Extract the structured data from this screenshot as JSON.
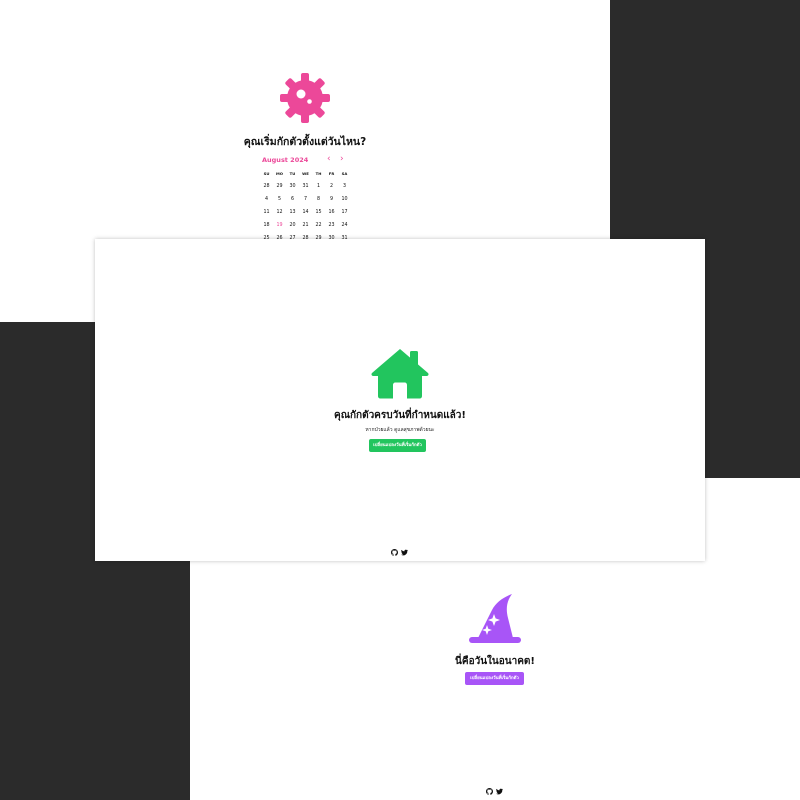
{
  "colors": {
    "pink": "#ec4899",
    "green": "#22c55e",
    "purple": "#a855f7",
    "background": "#2b2b2b"
  },
  "start_screen": {
    "icon": "gear-virus-icon",
    "question": "คุณเริ่มกักตัวตั้งแต่วันไหน?",
    "calendar": {
      "month_label": "August 2024",
      "prev_icon": "‹",
      "next_icon": "›",
      "weekdays": [
        "SU",
        "MO",
        "TU",
        "WE",
        "TH",
        "FR",
        "SA"
      ],
      "days": [
        "28",
        "29",
        "30",
        "31",
        "1",
        "2",
        "3",
        "4",
        "5",
        "6",
        "7",
        "8",
        "9",
        "10",
        "11",
        "12",
        "13",
        "14",
        "15",
        "16",
        "17",
        "18",
        "19",
        "20",
        "21",
        "22",
        "23",
        "24",
        "25",
        "26",
        "27",
        "28",
        "29",
        "30",
        "31"
      ],
      "today": "19"
    }
  },
  "done_screen": {
    "icon": "house-icon",
    "title": "คุณกักตัวครบวันที่กำหนดแล้ว!",
    "subtitle": "หากป่วยแล้ว ดูแลสุขภาพด้วยนะ",
    "button": "เปลี่ยนแปลงวันที่เริ่มกักตัว",
    "footer_icons": [
      "github-icon",
      "twitter-icon"
    ]
  },
  "future_screen": {
    "icon": "wizard-hat-icon",
    "title": "นี่คือวันในอนาคต!",
    "button": "เปลี่ยนแปลงวันที่เริ่มกักตัว",
    "footer_icons": [
      "github-icon",
      "twitter-icon"
    ]
  }
}
